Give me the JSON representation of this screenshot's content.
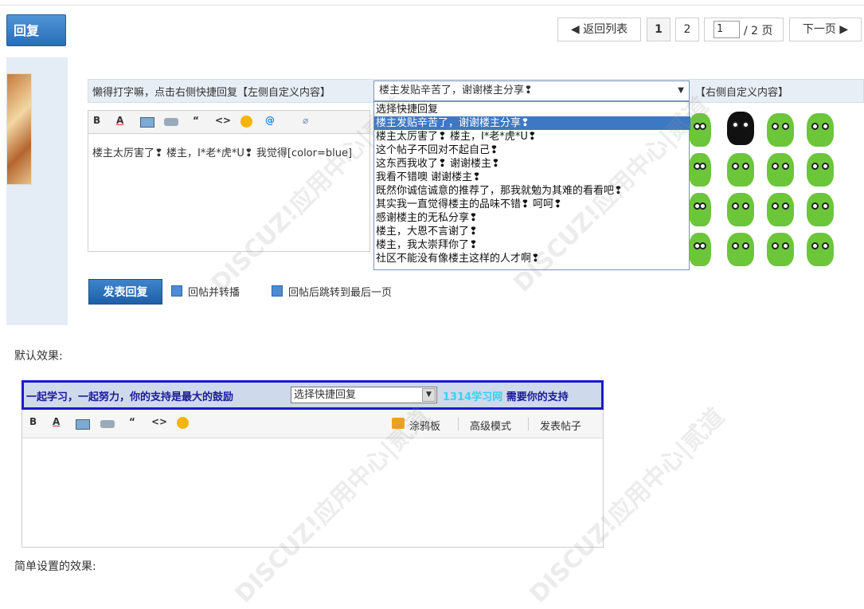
{
  "topbar": {
    "reply_button": "回复",
    "back_to_list": "◀ 返回列表",
    "page_1": "1",
    "page_2": "2",
    "page_input_value": "1",
    "page_total": "/ 2 页",
    "next_page": "下一页 ▶"
  },
  "quick_reply": {
    "left_custom": "懒得打字嘛，点击右侧快捷回复【左侧自定义内容】",
    "selected": "楼主发贴辛苦了，谢谢楼主分享❢",
    "right_custom": "【右侧自定义内容】",
    "options": [
      "选择快捷回复",
      "楼主发贴辛苦了，谢谢楼主分享❢",
      "楼主太厉害了❢ 楼主，I*老*虎*U❢",
      "这个帖子不回对不起自己❢",
      "这东西我收了❢ 谢谢楼主❢",
      "我看不错噢 谢谢楼主❢",
      "既然你诚信诚意的推荐了，那我就勉为其难的看看吧❢",
      "其实我一直觉得楼主的品味不错❢ 呵呵❢",
      "感谢楼主的无私分享❢",
      "楼主，大恩不言谢了❢",
      "楼主，我太崇拜你了❢",
      "社区不能没有像楼主这样的人才啊❢"
    ]
  },
  "editor": {
    "text": "楼主太厉害了❢ 楼主，I*老*虎*U❢ 我觉得[color=blue]"
  },
  "submit": {
    "label": "发表回复",
    "option1": "回帖并转播",
    "option2": "回帖后跳转到最后一页"
  },
  "default_effect": {
    "label": "默认效果:",
    "left_text": "一起学习，一起努力，你的支持是最大的鼓励",
    "select": "选择快捷回复",
    "right_text_1": "1314学习网",
    "right_text_2": "需要你的支持",
    "doodle": "涂鸦板",
    "advanced": "高级模式",
    "post": "发表帖子",
    "link_color": "#3ad0f0"
  },
  "simple_effect": {
    "label": "简单设置的效果:"
  },
  "watermark": {
    "text": "DISCUZ!应用中心|贰道"
  }
}
